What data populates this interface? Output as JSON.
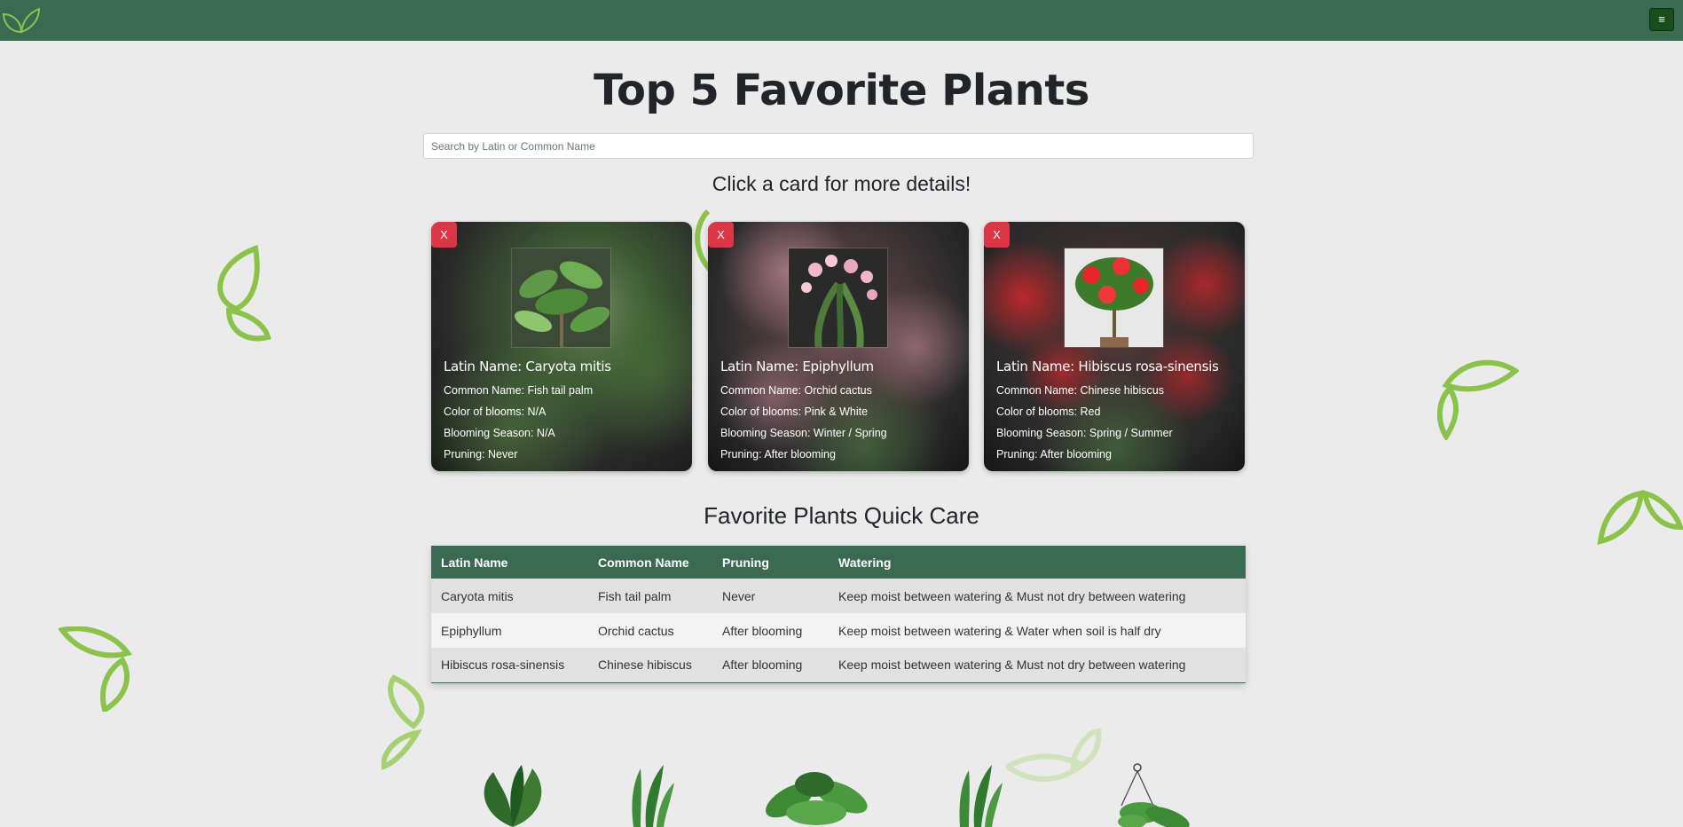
{
  "header": {
    "menu_label": "≡"
  },
  "page": {
    "title": "Top 5 Favorite Plants",
    "subtitle": "Click a card for more details!"
  },
  "search": {
    "placeholder": "Search by Latin or Common Name",
    "value": ""
  },
  "cards": [
    {
      "close_label": "X",
      "latin": "Latin Name: Caryota mitis",
      "common": "Common Name: Fish tail palm",
      "color": "Color of blooms: N/A",
      "season": "Blooming Season: N/A",
      "pruning": "Pruning: Never",
      "accent": "#3f8a3a"
    },
    {
      "close_label": "X",
      "latin": "Latin Name: Epiphyllum",
      "common": "Common Name: Orchid cactus",
      "color": "Color of blooms: Pink & White",
      "season": "Blooming Season: Winter / Spring",
      "pruning": "Pruning: After blooming",
      "accent": "#e8a3b5"
    },
    {
      "close_label": "X",
      "latin": "Latin Name: Hibiscus rosa-sinensis",
      "common": "Common Name: Chinese hibiscus",
      "color": "Color of blooms: Red",
      "season": "Blooming Season: Spring / Summer",
      "pruning": "Pruning: After blooming",
      "accent": "#e8262b"
    }
  ],
  "care": {
    "title": "Favorite Plants Quick Care",
    "headers": [
      "Latin Name",
      "Common Name",
      "Pruning",
      "Watering"
    ],
    "rows": [
      [
        "Caryota mitis",
        "Fish tail palm",
        "Never",
        "Keep moist between watering & Must not dry between watering"
      ],
      [
        "Epiphyllum",
        "Orchid cactus",
        "After blooming",
        "Keep moist between watering & Water when soil is half dry"
      ],
      [
        "Hibiscus rosa-sinensis",
        "Chinese hibiscus",
        "After blooming",
        "Keep moist between watering & Must not dry between watering"
      ]
    ]
  },
  "colors": {
    "nav": "#3a6b52",
    "close": "#dc3545",
    "leaf": "#8bc34a"
  }
}
